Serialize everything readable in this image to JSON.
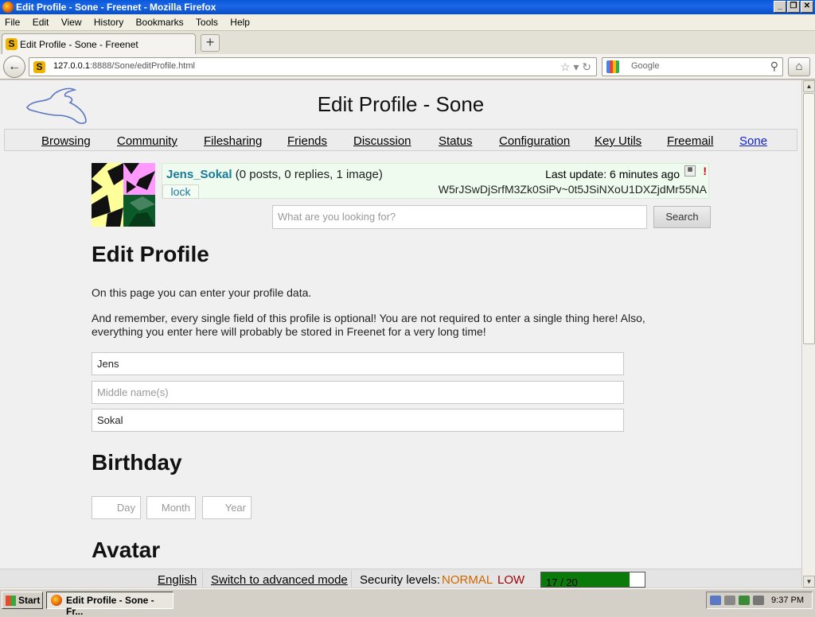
{
  "window": {
    "title": "Edit Profile - Sone - Freenet - Mozilla Firefox",
    "controls": [
      "_",
      "❐",
      "✕"
    ]
  },
  "menu": [
    "File",
    "Edit",
    "View",
    "History",
    "Bookmarks",
    "Tools",
    "Help"
  ],
  "tab": {
    "label": "Edit Profile - Sone - Freenet",
    "new_tab": "+"
  },
  "nav": {
    "url_host": "127.0.0.1",
    "url_rest": ":8888/Sone/editProfile.html",
    "search_placeholder": "Google"
  },
  "page": {
    "title": "Edit Profile - Sone",
    "nav_links": [
      "Browsing",
      "Community",
      "Filesharing",
      "Friends",
      "Discussion",
      "Status",
      "Configuration",
      "Key Utils",
      "Freemail",
      "Sone"
    ],
    "active_link": "Sone"
  },
  "sone": {
    "name": "Jens_Sokal",
    "stats": "(0 posts, 0 replies, 1 image)",
    "last_update": "Last update: 6 minutes ago",
    "lock_label": "lock",
    "id": "W5rJSwDjSrfM3Zk0SiPv~0t5JSiNXoU1DXZjdMr55NA",
    "alert": "!"
  },
  "search": {
    "placeholder": "What are you looking for?",
    "button": "Search"
  },
  "edit": {
    "heading": "Edit Profile",
    "intro": "On this page you can enter your profile data.",
    "note": "And remember, every single field of this profile is optional! You are not required to enter a single thing here! Also, everything you enter here will probably be stored in Freenet for a very long time!",
    "first_name": "Jens",
    "middle_placeholder": "Middle name(s)",
    "last_name": "Sokal"
  },
  "birthday": {
    "heading": "Birthday",
    "day_placeholder": "Day",
    "month_placeholder": "Month",
    "year_placeholder": "Year"
  },
  "avatar": {
    "heading": "Avatar"
  },
  "footer": {
    "language": "English",
    "advanced_mode": "Switch to advanced mode",
    "security_label": "Security levels:",
    "security_network": "NORMAL",
    "security_physical": "LOW",
    "peers_text": "17 / 20",
    "peers_fraction": 0.85,
    "colors": {
      "normal": "#cc6600",
      "low": "#990000",
      "bar": "#0a7a0a"
    }
  },
  "taskbar": {
    "start": "Start",
    "item": "Edit Profile - Sone - Fr...",
    "clock": "9:37 PM"
  }
}
